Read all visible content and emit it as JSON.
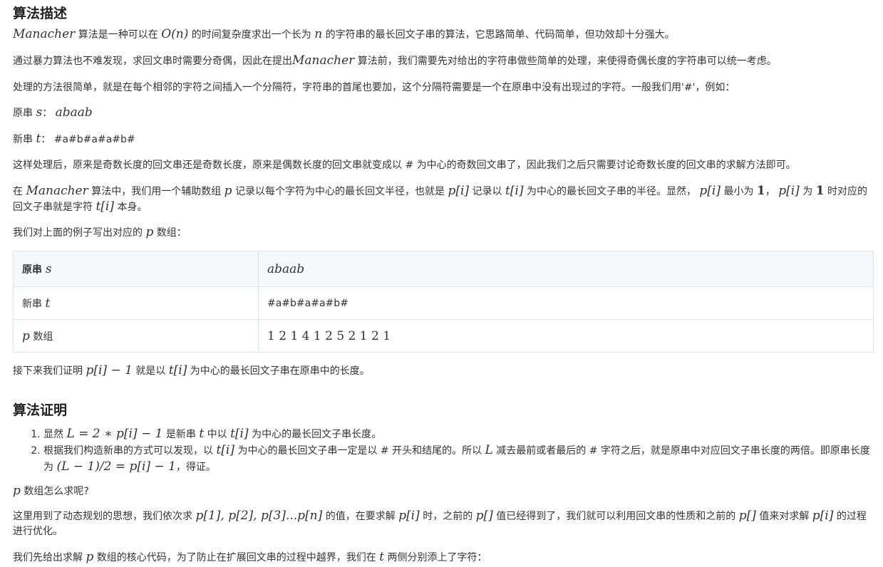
{
  "h1": "算法描述",
  "p1": [
    "Manacher",
    " 算法是一种可以在 ",
    "O(n)",
    " 的时间复杂度求出一个长为 ",
    "n",
    " 的字符串的最长回文子串的算法，它思路简单、代码简单，但功效却十分强大。"
  ],
  "p2": [
    "通过暴力算法也不难发现，求回文串时需要分奇偶，因此在提出",
    "Manacher",
    " 算法前，我们需要先对给出的字符串做些简单的处理，来使得奇偶长度的字符串可以统一考虑。"
  ],
  "p3": "处理的方法很简单，就是在每个相邻的字符之间插入一个分隔符，字符串的首尾也要加，这个分隔符需要是一个在原串中没有出现过的字符。一般我们用'#'，例如：",
  "p4": [
    "原串 ",
    "s",
    "：  ",
    "abaab"
  ],
  "p5": [
    "新串 ",
    "t",
    "：  ",
    "#a#b#a#a#b#"
  ],
  "p6": "这样处理后，原来是奇数长度的回文串还是奇数长度，原来是偶数长度的回文串就变成以 # 为中心的奇数回文串了，因此我们之后只需要讨论奇数长度的回文串的求解方法即可。",
  "p7": [
    "在 ",
    "Manacher",
    " 算法中，我们用一个辅助数组 ",
    "p",
    " 记录以每个字符为中心的最长回文半径，也就是 ",
    "p[i]",
    " 记录以 ",
    "t[i]",
    " 为中心的最长回文子串的半径。显然， ",
    "p[i]",
    " 最小为 ",
    "1",
    "， ",
    "p[i]",
    " 为 ",
    "1",
    " 时对应的回文子串就是字符 ",
    "t[i]",
    " 本身。"
  ],
  "p8": [
    "我们对上面的例子写出对应的 ",
    "p",
    " 数组："
  ],
  "table": {
    "head": [
      "原串 ",
      "s",
      "abaab"
    ],
    "row1": [
      "新串 ",
      "t",
      "#a#b#a#a#b#"
    ],
    "row2": [
      "p",
      " 数组",
      "1 2 1 4 1 2 5 2 1 2 1"
    ]
  },
  "p9": [
    "接下来我们证明 ",
    "p[i] − 1",
    " 就是以 ",
    "t[i]",
    " 为中心的最长回文子串在原串中的长度。"
  ],
  "h2": "算法证明",
  "li1": [
    "显然 ",
    "L = 2 ∗ p[i] − 1",
    " 是新串 ",
    "t",
    " 中以 ",
    "t[i]",
    " 为中心的最长回文子串长度。"
  ],
  "li2": [
    "根据我们构造新串的方式可以发现，以 ",
    "t[i]",
    " 为中心的最长回文子串一定是以 # 开头和结尾的。所以 ",
    "L",
    " 减去最前或者最后的 # 字符之后，就是原串中对应回文子串长度的两倍。即原串长度为 ",
    "(L − 1)/2 = p[i] − 1",
    "，得证。"
  ],
  "p10": [
    "p",
    " 数组怎么求呢?"
  ],
  "p11": [
    "这里用到了动态规划的思想，我们依次求 ",
    "p[1], p[2], p[3]...p[n]",
    " 的值，在要求解 ",
    "p[i]",
    " 时，之前的 ",
    "p[]",
    " 值已经得到了，我们就可以利用回文串的性质和之前的 ",
    "p[]",
    " 值来对求解 ",
    "p[i]",
    " 的过程进行优化。"
  ],
  "p12": [
    "我们先给出求解 ",
    "p",
    " 数组的核心代码，为了防止在扩展回文串的过程中越界，我们在 ",
    "t",
    " 两侧分别添上了字符："
  ]
}
